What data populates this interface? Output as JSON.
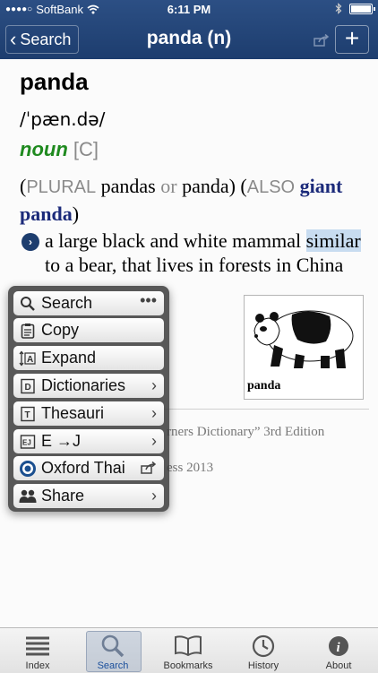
{
  "status_bar": {
    "carrier": "SoftBank",
    "time": "6:11 PM"
  },
  "nav": {
    "back_label": "Search",
    "title": "panda (n)"
  },
  "entry": {
    "headword": "panda",
    "pronunciation": "/ˈpæn.də/",
    "part_of_speech": "noun",
    "grammar_code": "[C]",
    "plural_label": "PLURAL",
    "plural_form_1": "pandas",
    "or_text": "or",
    "plural_form_2": "panda",
    "also_label": "ALSO",
    "also_word": "giant panda",
    "definition_before": "a large black and white mammal",
    "definition_highlight": "similar",
    "definition_after": "to a bear, that lives in forests in China",
    "picture_caption": "panda"
  },
  "copyright": {
    "line1": "rners Dictionary” 3rd Edition",
    "line2": "ess 2013"
  },
  "popup_menu": {
    "items": [
      {
        "label": "Search",
        "icon": "search-icon",
        "end": "•••"
      },
      {
        "label": "Copy",
        "icon": "clipboard-icon"
      },
      {
        "label": "Expand",
        "icon": "expand-icon"
      },
      {
        "label": "Dictionaries",
        "icon": "dictionary-icon",
        "end": "chevron"
      },
      {
        "label": "Thesauri",
        "icon": "thesaurus-icon",
        "end": "chevron"
      },
      {
        "label": "E →J",
        "icon": "ej-icon",
        "end": "chevron"
      },
      {
        "label": "Oxford Thai",
        "icon": "oxford-thai-icon",
        "end": "share"
      },
      {
        "label": "Share",
        "icon": "people-icon",
        "end": "chevron"
      }
    ]
  },
  "tabs": [
    {
      "label": "Index",
      "icon": "list-icon"
    },
    {
      "label": "Search",
      "icon": "search-icon",
      "active": true
    },
    {
      "label": "Bookmarks",
      "icon": "book-icon"
    },
    {
      "label": "History",
      "icon": "clock-icon"
    },
    {
      "label": "About",
      "icon": "info-icon"
    }
  ],
  "colors": {
    "nav_bar": "#1d3d6e",
    "part_of_speech": "#1f8a1f",
    "also_word": "#1b2a7a",
    "highlight": "#c8dcf0",
    "active_tab": "#1a4f9c"
  }
}
